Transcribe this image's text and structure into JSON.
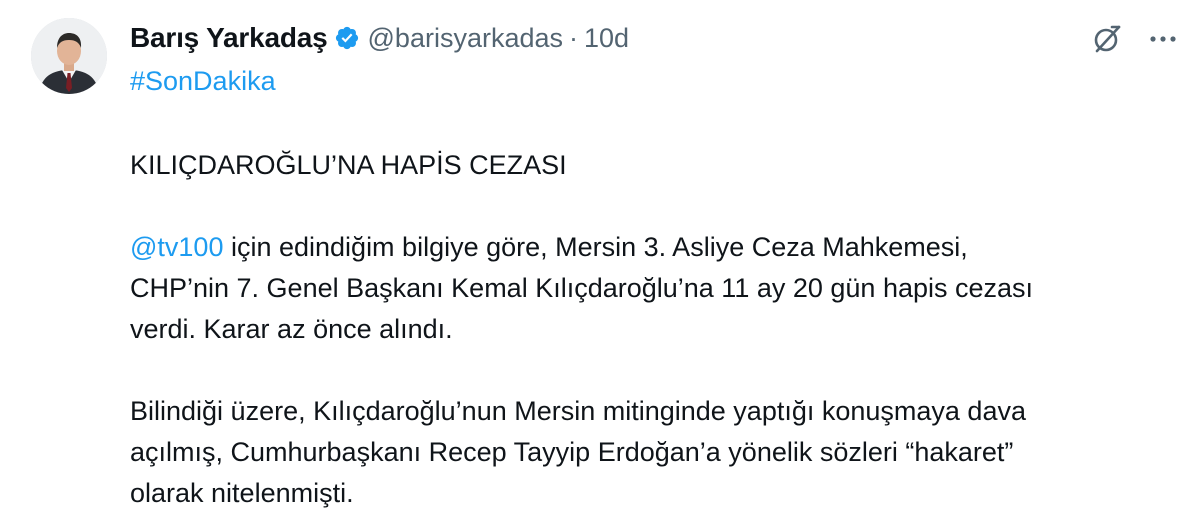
{
  "author": {
    "display_name": "Barış Yarkadaş",
    "handle": "@barisyarkadas",
    "separator": "·",
    "time": "10d",
    "verified": true
  },
  "colors": {
    "link": "#1d9bf0",
    "text": "#0f1419",
    "secondary": "#536471"
  },
  "icons": {
    "verified": "verified-badge-icon",
    "grok": "grok-icon",
    "more": "more-icon"
  },
  "tweet": {
    "hashtag": "#SonDakika",
    "headline": "KILIÇDAROĞLU’NA HAPİS CEZASI",
    "mention": "@tv100",
    "p2_line1_rest": " için edindiğim bilgiye göre, Mersin 3. Asliye Ceza Mahkemesi,",
    "p2_line2": "CHP’nin 7. Genel Başkanı Kemal Kılıçdaroğlu’na 11 ay 20 gün hapis cezası",
    "p2_line3": "verdi. Karar az önce alındı.",
    "p3_line1": "Bilindiği üzere, Kılıçdaroğlu’nun Mersin mitinginde yaptığı konuşmaya dava",
    "p3_line2": "açılmış, Cumhurbaşkanı Recep Tayyip Erdoğan’a yönelik sözleri “hakaret”",
    "p3_line3": "olarak nitelenmişti."
  }
}
